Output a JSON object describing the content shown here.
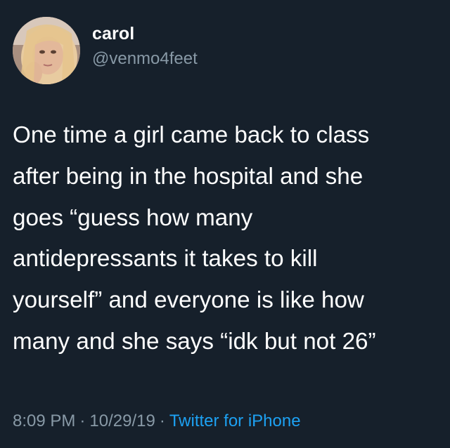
{
  "user": {
    "display_name": "carol",
    "handle": "@venmo4feet",
    "avatar_icon": "profile-photo"
  },
  "tweet": {
    "lines": [
      "One time a girl came back to class",
      "after being in the hospital and she",
      "goes “guess how many",
      "antidepressants it takes to kill",
      "yourself” and everyone is like how",
      "many and she says “idk but not 26”"
    ]
  },
  "meta": {
    "time": "8:09 PM",
    "separator": "·",
    "date": "10/29/19",
    "source": "Twitter for iPhone"
  },
  "colors": {
    "background": "#16202b",
    "text": "#ffffff",
    "secondary_text": "#8899a6",
    "link": "#1da1f2"
  }
}
